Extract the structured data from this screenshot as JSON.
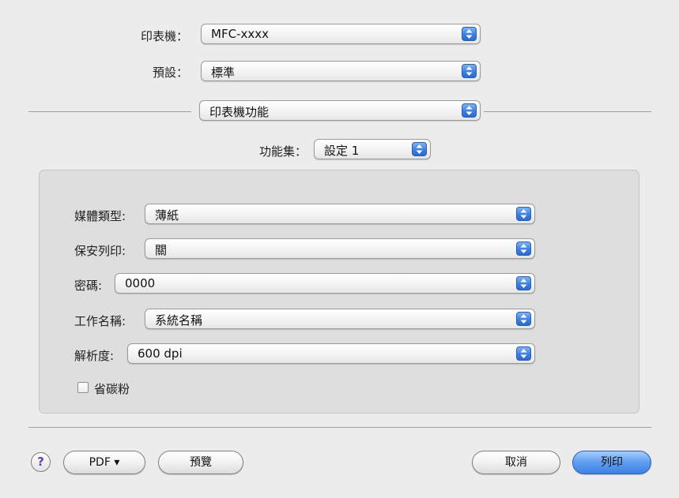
{
  "printer": {
    "label": "印表機：",
    "value": "MFC-xxxx"
  },
  "presets": {
    "label": "預設：",
    "value": "標準"
  },
  "section": {
    "value": "印表機功能"
  },
  "feature_sets": {
    "label": "功能集：",
    "value": "設定 1"
  },
  "panel": {
    "media_type": {
      "label": "媒體類型:",
      "value": "薄紙"
    },
    "secure_print": {
      "label": "保安列印:",
      "value": "關"
    },
    "password": {
      "label": "密碼:",
      "value": "0000"
    },
    "job_name": {
      "label": "工作名稱:",
      "value": "系統名稱"
    },
    "resolution": {
      "label": "解析度:",
      "value": "600 dpi"
    },
    "toner_save": {
      "label": "省碳粉",
      "checked": false
    }
  },
  "footer": {
    "help": "?",
    "pdf": "PDF ▾",
    "preview": "預覽",
    "cancel": "取消",
    "print": "列印"
  },
  "colors": {
    "accent": "#3d7fe0",
    "window_bg": "#ececec",
    "panel_bg": "#dedede"
  },
  "icons": {
    "popup_arrows": "up-down-arrows-icon",
    "help": "help-icon",
    "dropdown": "triangle-down-icon"
  }
}
